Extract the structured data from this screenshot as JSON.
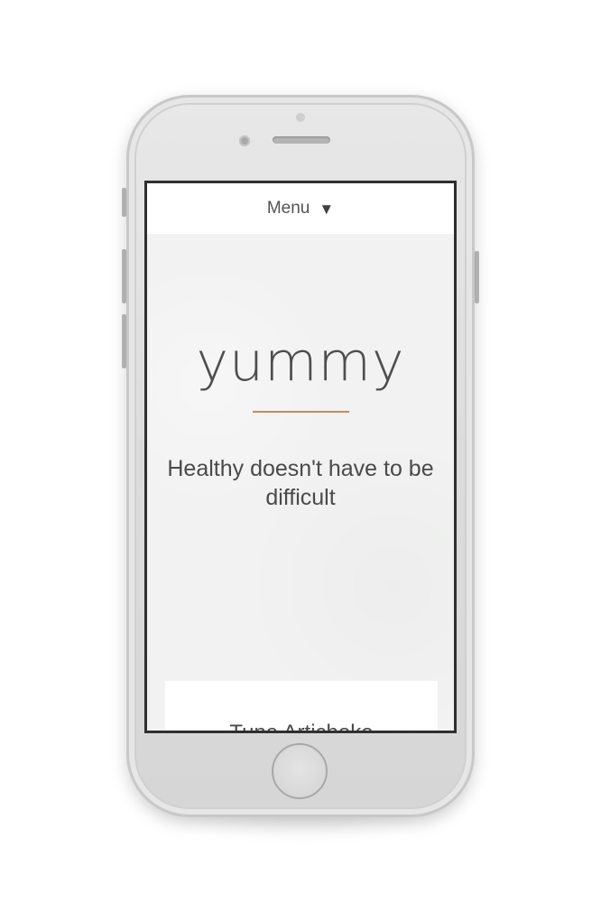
{
  "nav": {
    "menu_label": "Menu",
    "menu_arrow": "▼"
  },
  "hero": {
    "logo_text": "yummy",
    "tagline": "Healthy doesn't have to be difficult"
  },
  "recipe_card": {
    "title": "Tuna Artichoke"
  },
  "colors": {
    "accent_divider": "#c98a5c",
    "text": "#4a4a4a",
    "hero_background": "#f1f2f1"
  },
  "icons": {
    "menu_toggle": "caret-down-icon"
  }
}
